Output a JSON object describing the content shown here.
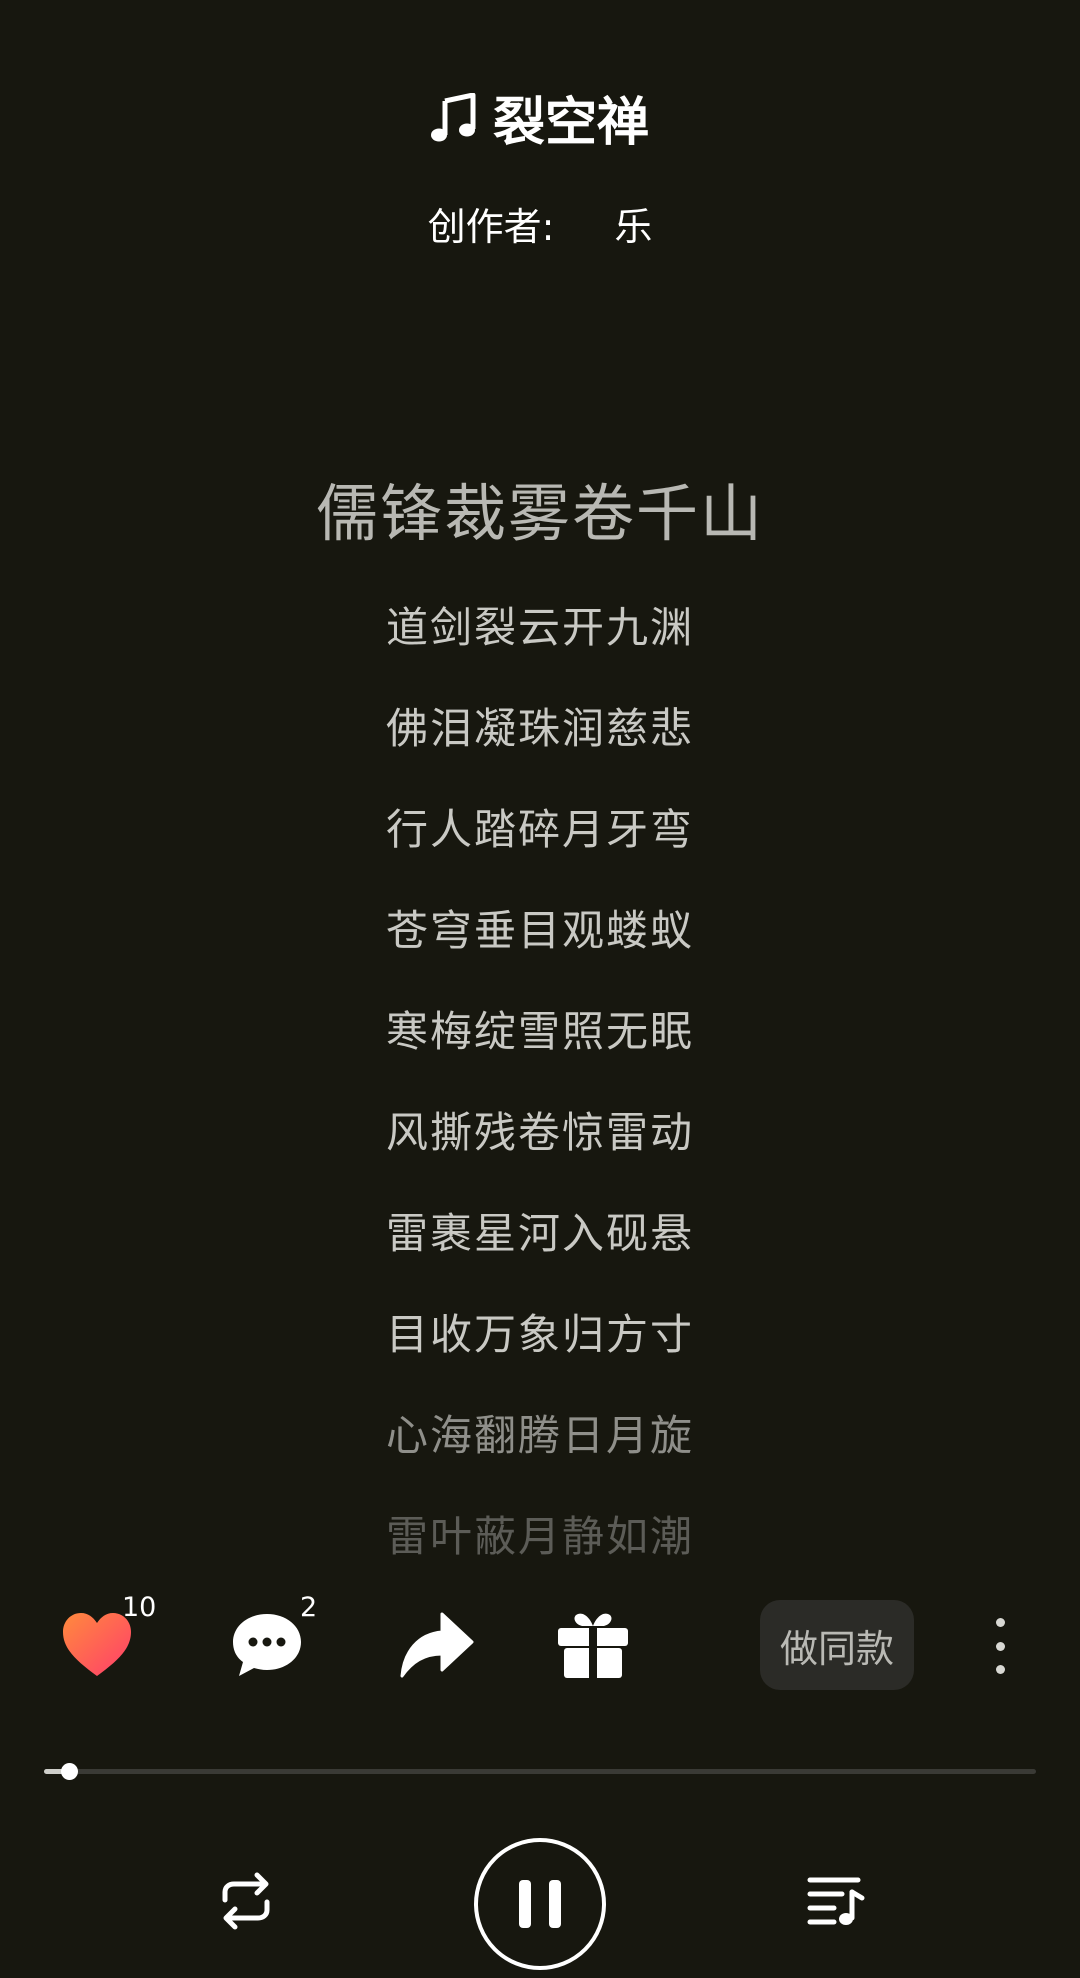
{
  "header": {
    "title": "裂空禅",
    "creator_label": "创作者:",
    "creator_name": "乐"
  },
  "lyrics": [
    "儒锋裁雾卷千山",
    "道剑裂云开九渊",
    "佛泪凝珠润慈悲",
    "行人踏碎月牙弯",
    "苍穹垂目观蝼蚁",
    "寒梅绽雪照无眠",
    "风撕残卷惊雷动",
    "雷裹星河入砚悬",
    "目收万象归方寸",
    "心海翻腾日月旋",
    "雷叶蔽月静如潮"
  ],
  "actions": {
    "like_count": "10",
    "comment_count": "2",
    "same_style_label": "做同款"
  },
  "player": {
    "progress_fraction": 0.025
  },
  "icons": {
    "title": "music-note-icon",
    "like": "heart-icon",
    "comment": "comment-bubble-icon",
    "share": "share-arrow-icon",
    "gift": "gift-icon",
    "more": "more-vertical-icon",
    "repeat": "repeat-icon",
    "pause": "pause-icon",
    "playlist": "playlist-icon"
  },
  "colors": {
    "background": "#17170f",
    "like_gradient_start": "#ff8a3d",
    "like_gradient_end": "#ff3d6b"
  }
}
